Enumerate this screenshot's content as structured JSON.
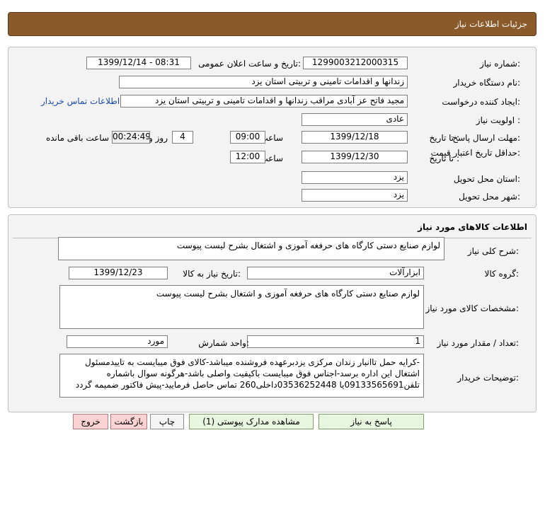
{
  "header": {
    "title": "جزئیات اطلاعات نیاز"
  },
  "info": {
    "need_number_label": "شماره نیاز:",
    "need_number": "1299003212000315",
    "announce_label": "تاریخ و ساعت اعلان عمومی:",
    "announce_value": "1399/12/14 - 08:31",
    "buyer_label": "نام دستگاه خریدار:",
    "buyer_value": "زندانها و اقدامات تامینی و تربیتی استان یزد",
    "requester_label": "ایجاد کننده درخواست:",
    "requester_value": "مجید فاتح عز آبادی  مراقب زندانها و اقدامات تامینی و تربیتی استان یزد",
    "contact_link": "اطلاعات تماس خریدار",
    "priority_label": "اولویت نیاز :",
    "priority_value": "عادی",
    "deadline_label": "مهلت ارسال پاسخ:",
    "to_date_label": "تا تاریخ :",
    "deadline_date": "1399/12/18",
    "time_label": "ساعت",
    "deadline_time": "09:00",
    "days_value": "4",
    "days_label": "روز و",
    "remaining_time": "00:24:49",
    "remaining_label": "ساعت باقی مانده",
    "validity_label": "حداقل تاریخ اعتبار قیمت:",
    "validity_to_label": "تا تاریخ :",
    "validity_date": "1399/12/30",
    "validity_time_label": "ساعت",
    "validity_time": "12:00",
    "province_label": "استان محل تحویل:",
    "province_value": "یزد",
    "city_label": "شهر محل تحویل:",
    "city_value": "یزد"
  },
  "goods": {
    "section_title": "اطلاعات کالاهای مورد نیاز",
    "general_desc_label": "شرح کلی نیاز:",
    "general_desc": "لوازم صنایع دستی کارگاه های حرفغه آموزی و اشتغال بشرح لیست پیوست",
    "group_label": "گروه کالا:",
    "group_value": "ابزارآلات",
    "need_date_label": "تاریخ نیاز به کالا:",
    "need_date": "1399/12/23",
    "specs_label": "مشخصات کالای مورد نیاز:",
    "specs_value": "لوازم صنایع دستی کارگاه های حرفغه آموزی و اشتغال بشرح لیست پیوست",
    "qty_label": "تعداد / مقدار مورد نیاز:",
    "qty_value": "1",
    "unit_label": "واحد شمارش:",
    "unit_value": "مورد",
    "buyer_notes_label": "توضیحات خریدار:",
    "buyer_notes_line1": "-کرایه حمل تاانبار زندان مرکزی یزدبرعهده فروشنده میباشد-کالای فوق میبایست به تاییدمسئول",
    "buyer_notes_line2": "اشتغال این اداره برسد-اجناس فوق میبایست باکیفیت واصلی باشد-هرگونه سوال باشماره",
    "buyer_notes_line3": "تلفن09133565691یا 03536252448داخلی260 تماس حاصل فرمایید-پیش فاکتور ضمیمه گردد"
  },
  "actions": {
    "reply": "پاسخ به نیاز",
    "attachments": "مشاهده مدارک پیوستی (1)",
    "print": "چاپ",
    "back": "بازگشت",
    "exit": "خروج"
  }
}
